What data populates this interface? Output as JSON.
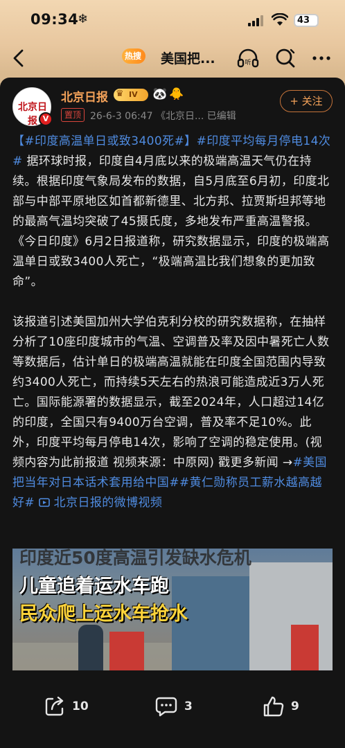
{
  "status_bar": {
    "time": "09:34",
    "extra_icon": "❄",
    "battery": "43"
  },
  "navbar": {
    "hot_badge": "热搜",
    "title": "美国把..."
  },
  "post": {
    "author": "北京日报",
    "avatar_text": "北京日报",
    "verified_mark": "V",
    "level": "IV",
    "pin_label": "置顶",
    "meta": "26-6-3 06:47 《北京日... 已编辑",
    "follow_label": "+ 关注",
    "paragraph1": {
      "tag_open": "【#印度高温单日或致3400死#】",
      "tag2": "#印度平均每月停电14次#",
      "text": " 据环球时报，印度自4月底以来的极端高温天气仍在持续。根据印度气象局发布的数据，自5月底至6月初，印度北部与中部平原地区如首都新德里、北方邦、拉贾斯坦邦等地的最高气温均突破了45摄氏度，多地发布严重高温警报。《今日印度》6月2日报道称，研究数据显示，印度的极端高温单日或致3400人死亡，“极端高温比我们想象的更加致命”。"
    },
    "paragraph2": {
      "text": "该报道引述美国加州大学伯克利分校的研究数据称，在抽样分析了10座印度城市的气温、空调普及率及因中暑死亡人数等数据后，估计单日的极端高温就能在印度全国范围内导致约3400人死亡，而持续5天左右的热浪可能造成近3万人死亡。国际能源署的数据显示，截至2024年，人口超过14亿的印度，全国只有9400万台空调，普及率不足10%。此外，印度平均每月停电14次，影响了空调的稳定使用。(视频内容为此前报道 视频来源：中原网) 戳更多新闻 →",
      "tag3": "#美国把当年对日本话术套用给中国#",
      "tag4": "#黄仁勋称员工薪水越高越好#",
      "video_link": " 北京日报的微博视频"
    },
    "video_captions": {
      "line1": "印度近50度高温引发缺水危机",
      "line2": "儿童追着运水车跑",
      "line3": "民众爬上运水车抢水"
    }
  },
  "actions": {
    "share_count": "10",
    "comment_count": "3",
    "like_count": "9"
  }
}
